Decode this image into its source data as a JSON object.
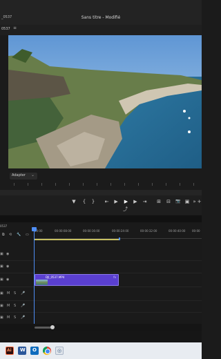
{
  "window": {
    "title": "Sans titre - Modifié",
    "left_tab": "_0537"
  },
  "monitor": {
    "panel_label": "0537",
    "menu_icon": "≡",
    "fit_select_value": "Adapter",
    "chevron": "⌄"
  },
  "transport": {
    "marker": "▼",
    "in_point": "{",
    "out_point": "}",
    "go_to_in": "⇤",
    "step_back": "◀",
    "play": "▶",
    "step_forward": "▶",
    "go_to_out": "⇥",
    "insert": "⊞",
    "overwrite": "⊟",
    "camera": "📷",
    "compare": "▣",
    "more": "»",
    "plus": "+",
    "export_frame": "⤴"
  },
  "timeline": {
    "label": "0537",
    "timecodes": [
      "00:00",
      "00:00:08:00",
      "00:00:16:00",
      "00:00:24:00",
      "00:00:32:00",
      "00:00:40:00",
      "00:00"
    ],
    "clip": {
      "name": "DJI_0537.MP4",
      "fx": "fx"
    }
  },
  "taskbar": {
    "ai": "Ai",
    "word": "W",
    "outlook": "O",
    "media": "◎"
  },
  "colors": {
    "accent": "#4f8ef6",
    "clip_fill": "#5a3fd0",
    "work_area": "#c8c062"
  }
}
